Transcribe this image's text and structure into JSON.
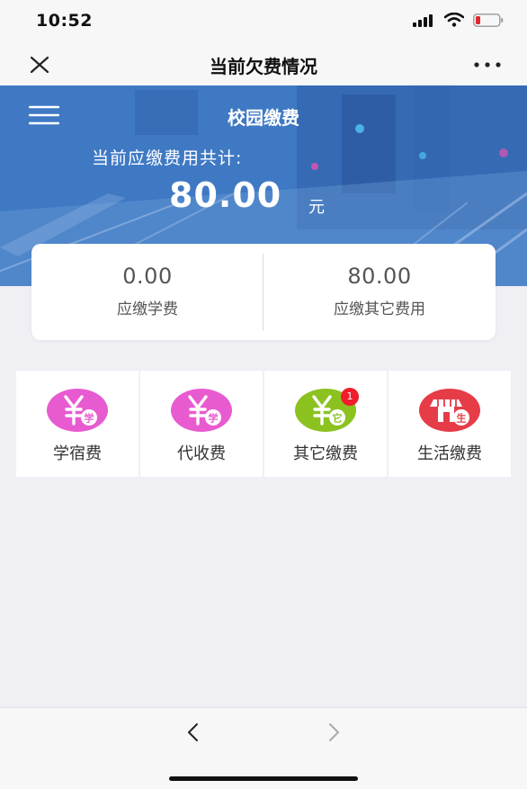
{
  "status_bar": {
    "time": "10:52"
  },
  "navbar": {
    "title": "当前欠费情况"
  },
  "banner": {
    "title": "校园缴费",
    "total_label": "当前应缴费用共计:",
    "total_amount": "80.00",
    "unit": "元"
  },
  "summary": {
    "tuition": {
      "value": "0.00",
      "label": "应缴学费"
    },
    "other": {
      "value": "80.00",
      "label": "应缴其它费用"
    }
  },
  "grid": {
    "items": [
      {
        "label": "学宿费",
        "icon": "yuan-study-icon",
        "icon_char": "学",
        "color": "#e85bd0"
      },
      {
        "label": "代收费",
        "icon": "yuan-study-icon",
        "icon_char": "学",
        "color": "#e85bd0"
      },
      {
        "label": "其它缴费",
        "icon": "yuan-other-icon",
        "icon_char": "它",
        "color": "#8bc220",
        "badge": "1"
      },
      {
        "label": "生活缴费",
        "icon": "shop-life-icon",
        "icon_char": "生",
        "color": "#e63c48"
      }
    ]
  },
  "colors": {
    "badge": "#f01e2a",
    "banner_blue": "#3a74c0"
  }
}
